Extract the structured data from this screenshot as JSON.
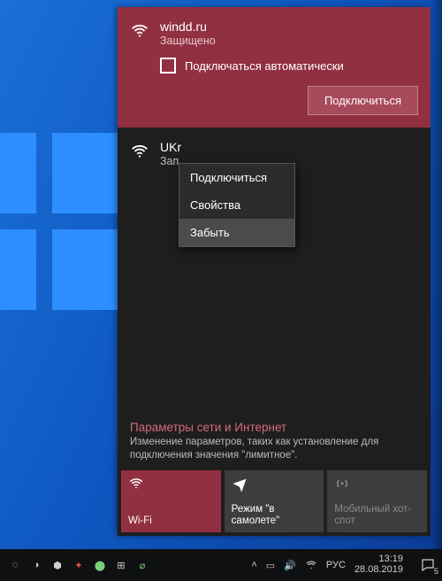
{
  "selected_network": {
    "ssid": "windd.ru",
    "status": "Защищено",
    "auto_label": "Подключаться автоматически",
    "connect_label": "Подключиться"
  },
  "second_network": {
    "ssid_visible": "UKr",
    "status_visible": "Зап"
  },
  "context_menu": {
    "items": [
      "Подключиться",
      "Свойства",
      "Забыть"
    ],
    "hover_index": 2
  },
  "settings": {
    "title": "Параметры сети и Интернет",
    "desc": "Изменение параметров, таких как установление для подключения значения \"лимитное\"."
  },
  "tiles": [
    {
      "label": "Wi-Fi",
      "state": "active",
      "icon": "wifi"
    },
    {
      "label": "Режим \"в самолете\"",
      "state": "inactive",
      "icon": "plane"
    },
    {
      "label": "Мобильный хот-спот",
      "state": "disabled",
      "icon": "hotspot"
    }
  ],
  "tray": {
    "lang": "РУС",
    "time": "13:19",
    "date": "28.08.2019",
    "notif_count": "5"
  }
}
